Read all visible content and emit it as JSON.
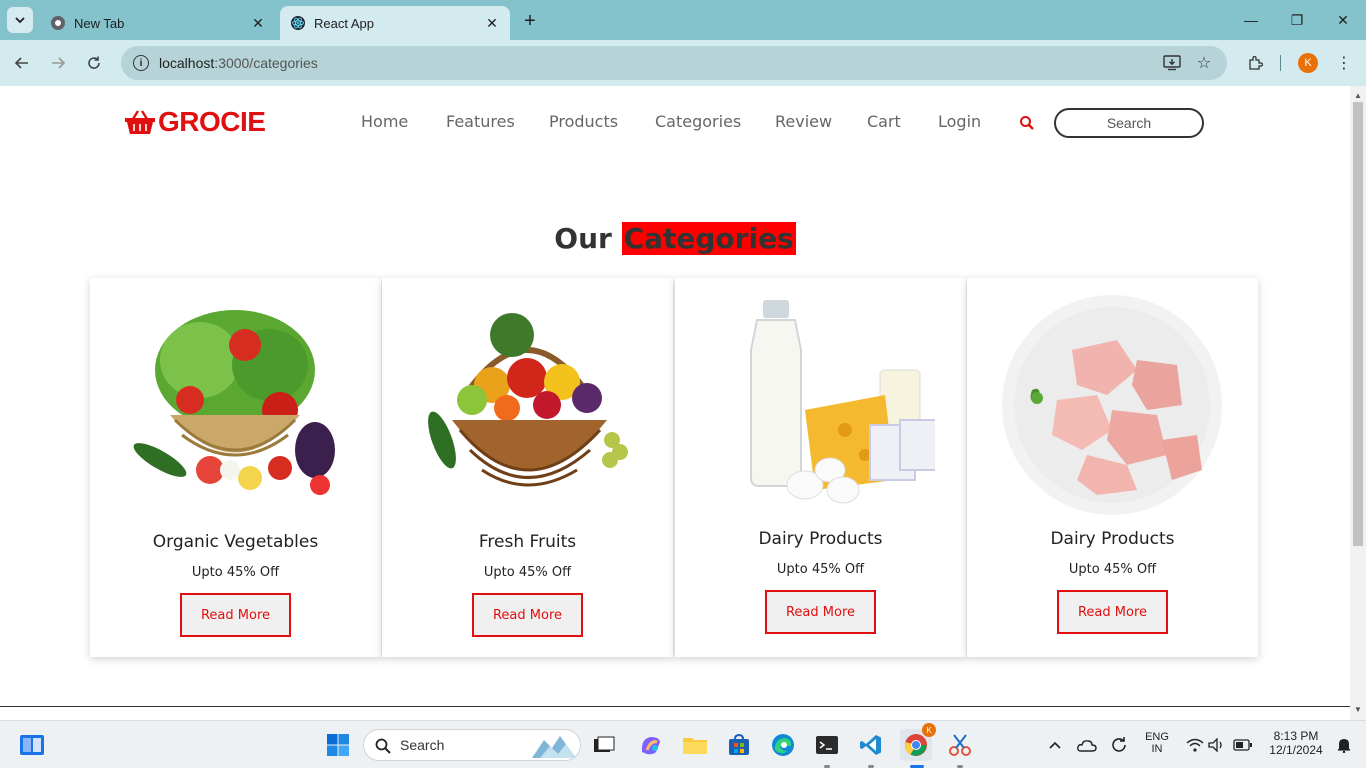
{
  "browser": {
    "tabs": [
      {
        "title": "New Tab",
        "active": false
      },
      {
        "title": "React App",
        "active": true
      }
    ],
    "url_host": "localhost",
    "url_path": ":3000/categories",
    "profile_initial": "K"
  },
  "site": {
    "logo_text": "GROCIE",
    "nav": [
      "Home",
      "Features",
      "Products",
      "Categories",
      "Review",
      "Cart",
      "Login"
    ],
    "search_placeholder": "Search",
    "section_title_plain": "Our",
    "section_title_highlight": "Categories",
    "accent_color": "#e01010",
    "categories": [
      {
        "name": "Organic Vegetables",
        "offer": "Upto 45% Off",
        "button": "Read More",
        "image": "vegetables-basket"
      },
      {
        "name": "Fresh Fruits",
        "offer": "Upto 45% Off",
        "button": "Read More",
        "image": "fruit-basket"
      },
      {
        "name": "Dairy Products",
        "offer": "Upto 45% Off",
        "button": "Read More",
        "image": "milk-cheese-eggs"
      },
      {
        "name": "Dairy Products",
        "offer": "Upto 45% Off",
        "button": "Read More",
        "image": "raw-chicken-plate"
      }
    ]
  },
  "taskbar": {
    "search_label": "Search",
    "language": "ENG",
    "region": "IN",
    "time": "8:13 PM",
    "date": "12/1/2024"
  }
}
